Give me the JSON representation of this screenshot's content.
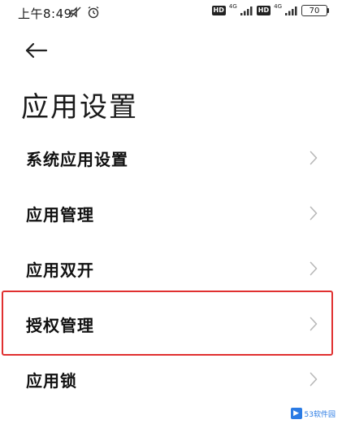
{
  "status_bar": {
    "time": "上午8:49",
    "hd_badge_1": "HD",
    "net_1": "4G",
    "hd_badge_2": "HD",
    "net_2": "4G",
    "battery_level": "70"
  },
  "header": {
    "back_icon": "arrow-left-icon",
    "title": "应用设置"
  },
  "settings": {
    "items": [
      {
        "label": "系统应用设置"
      },
      {
        "label": "应用管理"
      },
      {
        "label": "应用双开"
      },
      {
        "label": "授权管理"
      },
      {
        "label": "应用锁"
      }
    ],
    "highlighted_index": 3
  },
  "watermark": {
    "text": "53软件园"
  },
  "colors": {
    "highlight": "#e03030",
    "chevron": "#b8b8b8",
    "text": "#111111"
  }
}
